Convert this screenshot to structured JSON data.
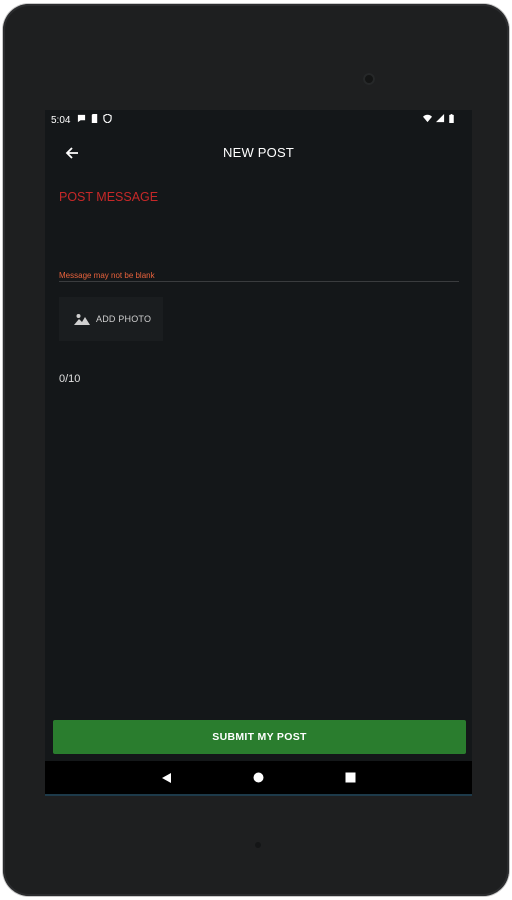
{
  "status_bar": {
    "time": "5:04"
  },
  "app_bar": {
    "title": "NEW POST"
  },
  "form": {
    "message_label": "POST MESSAGE",
    "message_value": "",
    "message_error": "Message may not be blank",
    "add_photo_label": "ADD PHOTO",
    "char_count": "0/10"
  },
  "submit_label": "SUBMIT MY POST",
  "colors": {
    "accent_error": "#c62828",
    "error_text": "#e8623c",
    "submit_bg": "#2a7d2e",
    "screen_bg": "#141719"
  }
}
